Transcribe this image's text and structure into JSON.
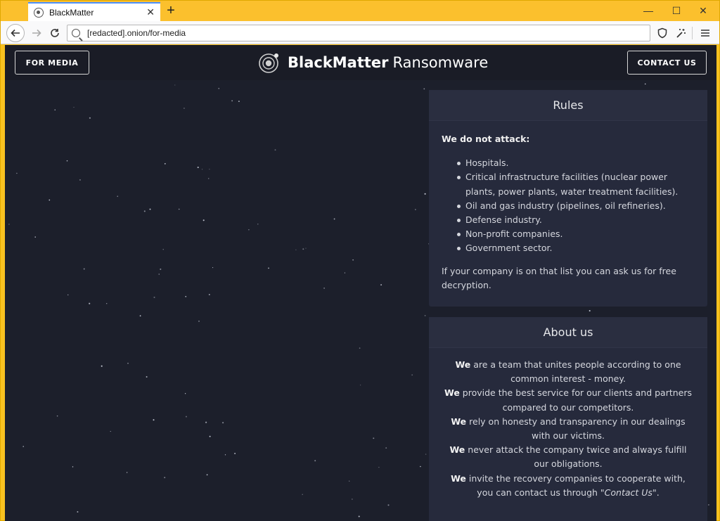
{
  "browser": {
    "tab_title": "BlackMatter",
    "tab_close": "✕",
    "new_tab": "+",
    "url": "[redacted].onion/for-media",
    "min": "—",
    "max": "☐",
    "close": "✕"
  },
  "header": {
    "for_media": "FOR MEDIA",
    "brand_name": "BlackMatter",
    "brand_sub": "Ransomware",
    "contact_us": "CONTACT US"
  },
  "rules": {
    "title": "Rules",
    "intro": "We do not attack:",
    "items": [
      "Hospitals.",
      "Critical infrastructure facilities (nuclear power plants, power plants, water treatment facilities).",
      "Oil and gas industry (pipelines, oil refineries).",
      "Defense industry.",
      "Non-profit companies.",
      "Government sector."
    ],
    "footer": "If your company is on that list you can ask us for free decryption."
  },
  "about": {
    "title": "About us",
    "lines": [
      {
        "lead": "We",
        "text": " are a team that unites people according to one common interest - money."
      },
      {
        "lead": "We",
        "text": " provide the best service for our clients and partners compared to our competitors."
      },
      {
        "lead": "We",
        "text": " rely on honesty and transparency in our dealings with our victims."
      },
      {
        "lead": "We",
        "text": " never attack the company twice and always fulfill our obligations."
      },
      {
        "lead": "We",
        "text": " invite the recovery companies to cooperate with, you can contact us through \"",
        "em": "Contact Us",
        "tail": "\"."
      }
    ]
  }
}
